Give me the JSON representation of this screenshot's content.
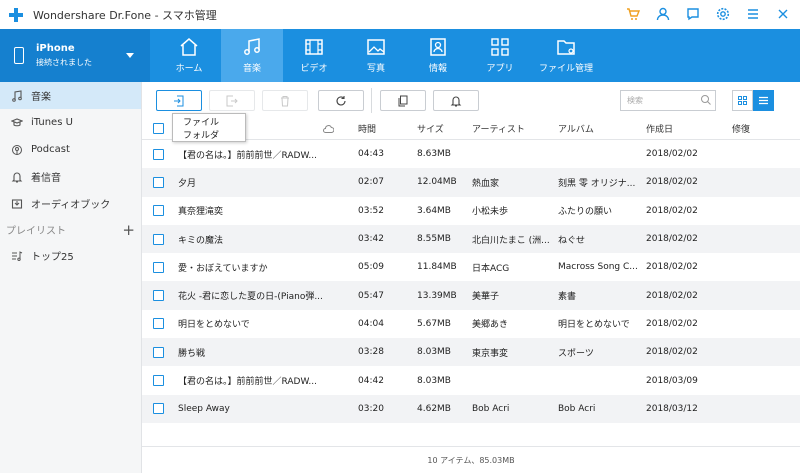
{
  "app": {
    "title": "Wondershare Dr.Fone - スマホ管理"
  },
  "title_icons": [
    "cart-icon",
    "user-icon",
    "feedback-icon",
    "settings-icon",
    "menu-icon",
    "close-icon"
  ],
  "device": {
    "name": "iPhone",
    "status": "接続されました"
  },
  "tabs": [
    {
      "label": "ホーム",
      "icon": "home-icon"
    },
    {
      "label": "音楽",
      "icon": "music-icon",
      "active": true
    },
    {
      "label": "ビデオ",
      "icon": "video-icon"
    },
    {
      "label": "写真",
      "icon": "photo-icon"
    },
    {
      "label": "情報",
      "icon": "contacts-icon"
    },
    {
      "label": "アプリ",
      "icon": "apps-icon"
    },
    {
      "label": "ファイル管理",
      "icon": "folder-icon"
    }
  ],
  "sidebar": {
    "items": [
      {
        "label": "音楽",
        "icon": "music-note-icon",
        "active": true
      },
      {
        "label": "iTunes U",
        "icon": "graduation-cap-icon"
      },
      {
        "label": "Podcast",
        "icon": "podcast-icon"
      },
      {
        "label": "着信音",
        "icon": "bell-icon"
      },
      {
        "label": "オーディオブック",
        "icon": "audiobook-icon"
      }
    ],
    "playlist_header": "プレイリスト",
    "add_symbol": "+",
    "playlists": [
      {
        "label": "トップ25",
        "icon": "playlist-icon"
      }
    ]
  },
  "search": {
    "placeholder": "検索"
  },
  "dropdown": {
    "items": [
      "ファイル",
      "フォルダ"
    ]
  },
  "table": {
    "headers": {
      "time": "時間",
      "size": "サイズ",
      "artist": "アーティスト",
      "album": "アルバム",
      "created": "作成日",
      "repair": "修復"
    },
    "rows": [
      {
        "title": "【君の名は。】前前前世／RADW...",
        "time": "04:43",
        "size": "8.63MB",
        "artist": "",
        "album": "",
        "created": "2018/02/02"
      },
      {
        "title": "夕月",
        "time": "02:07",
        "size": "12.04MB",
        "artist": "熱血家",
        "album": "刻黒 零 オリジナ...",
        "created": "2018/02/02"
      },
      {
        "title": "真奈狸滝奕",
        "time": "03:52",
        "size": "3.64MB",
        "artist": "小松未歩",
        "album": "ふたりの願い",
        "created": "2018/02/02"
      },
      {
        "title": "キミの魔法",
        "time": "03:42",
        "size": "8.55MB",
        "artist": "北白川たまこ (洲...",
        "album": "ねぐせ",
        "created": "2018/02/02"
      },
      {
        "title": "愛・おぼえていますか",
        "time": "05:09",
        "size": "11.84MB",
        "artist": "日本ACG",
        "album": "Macross Song C...",
        "created": "2018/02/02"
      },
      {
        "title": "花火 -君に恋した夏の日-(Piano弾...",
        "time": "05:47",
        "size": "13.39MB",
        "artist": "美華子",
        "album": "素書",
        "created": "2018/02/02"
      },
      {
        "title": "明日をとめないで",
        "time": "04:04",
        "size": "5.67MB",
        "artist": "美郷あき",
        "album": "明日をとめないで",
        "created": "2018/02/02"
      },
      {
        "title": "勝ち戦",
        "time": "03:28",
        "size": "8.03MB",
        "artist": "東京事変",
        "album": "スポーツ",
        "created": "2018/02/02"
      },
      {
        "title": "【君の名は。】前前前世／RADW...",
        "time": "04:42",
        "size": "8.03MB",
        "artist": "",
        "album": "",
        "created": "2018/03/09"
      },
      {
        "title": "Sleep Away",
        "time": "03:20",
        "size": "4.62MB",
        "artist": "Bob Acri",
        "album": "Bob Acri",
        "created": "2018/03/12"
      }
    ]
  },
  "footer": {
    "summary": "10 アイテム、85.03MB"
  },
  "colors": {
    "accent": "#1b8fe0",
    "active_tab": "#4aa9ec",
    "sidebar_active": "#d4e9f9"
  }
}
